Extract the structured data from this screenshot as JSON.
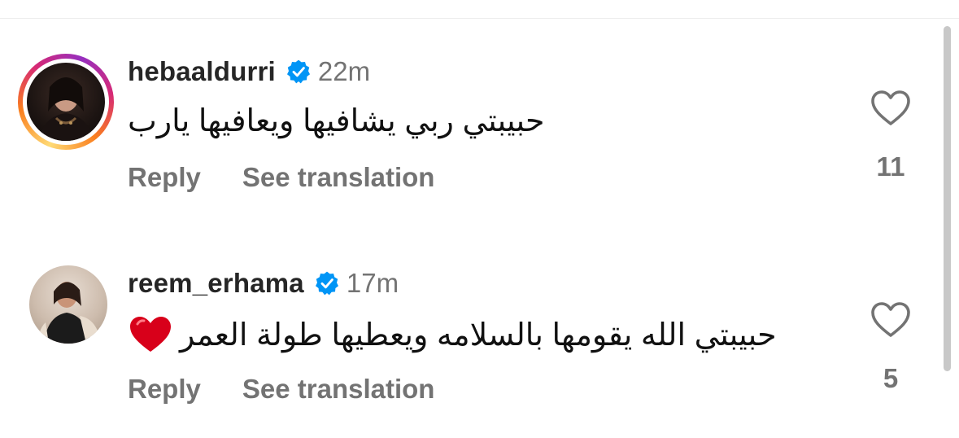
{
  "comments": [
    {
      "username": "hebaaldurri",
      "verified": true,
      "timestamp": "22m",
      "text": "حبيبتي ربي يشافيها ويعافيها يارب",
      "reply_label": "Reply",
      "translate_label": "See translation",
      "like_count": "11",
      "has_story_ring": true
    },
    {
      "username": "reem_erhama",
      "verified": true,
      "timestamp": "17m",
      "text": "حبيبتي الله يقومها بالسلامه ويعطيها طولة العمر",
      "emoji": "red-heart",
      "reply_label": "Reply",
      "translate_label": "See translation",
      "like_count": "5",
      "has_story_ring": false
    }
  ],
  "colors": {
    "username": "#262626",
    "secondary": "#737373",
    "verified_badge": "#0095f6",
    "heart_emoji": "#d8001a",
    "story_ring": [
      "#feda75",
      "#fa7e1e",
      "#d62976",
      "#962fbf"
    ]
  },
  "icons": {
    "verified": "verified-badge-icon",
    "like": "heart-outline-icon",
    "emoji": "red-heart-emoji"
  }
}
